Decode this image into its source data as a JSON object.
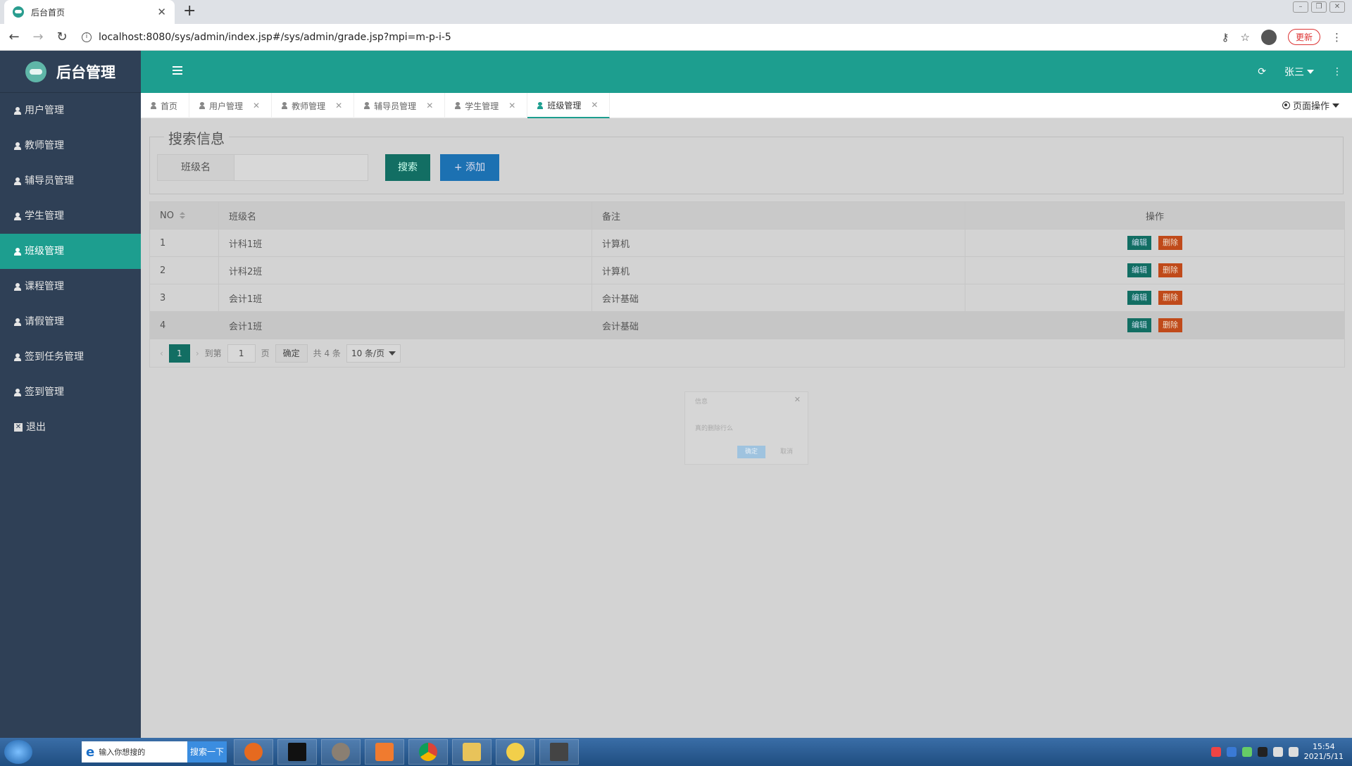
{
  "browser": {
    "tab_title": "后台首页",
    "url": "localhost:8080/sys/admin/index.jsp#/sys/admin/grade.jsp?mpi=m-p-i-5",
    "update_label": "更新"
  },
  "app": {
    "logo_text": "后台管理",
    "user_name": "张三",
    "page_ops_label": "页面操作"
  },
  "sidebar": {
    "items": [
      {
        "label": "用户管理"
      },
      {
        "label": "教师管理"
      },
      {
        "label": "辅导员管理"
      },
      {
        "label": "学生管理"
      },
      {
        "label": "班级管理"
      },
      {
        "label": "课程管理"
      },
      {
        "label": "请假管理"
      },
      {
        "label": "签到任务管理"
      },
      {
        "label": "签到管理"
      },
      {
        "label": "退出"
      }
    ],
    "active_index": 4
  },
  "tabs": [
    {
      "label": "首页"
    },
    {
      "label": "用户管理"
    },
    {
      "label": "教师管理"
    },
    {
      "label": "辅导员管理"
    },
    {
      "label": "学生管理"
    },
    {
      "label": "班级管理"
    }
  ],
  "search": {
    "legend": "搜索信息",
    "field_label": "班级名",
    "search_button": "搜索",
    "add_button": "添加"
  },
  "table": {
    "headers": [
      "NO",
      "班级名",
      "备注",
      "操作"
    ],
    "rows": [
      {
        "no": "1",
        "name": "计科1班",
        "remark": "计算机"
      },
      {
        "no": "2",
        "name": "计科2班",
        "remark": "计算机"
      },
      {
        "no": "3",
        "name": "会计1班",
        "remark": "会计基础"
      },
      {
        "no": "4",
        "name": "会计1班",
        "remark": "会计基础"
      }
    ],
    "edit_label": "编辑",
    "delete_label": "删除"
  },
  "pager": {
    "current_page": "1",
    "goto_label": "到第",
    "goto_value": "1",
    "page_suffix": "页",
    "confirm_label": "确定",
    "total_label": "共 4 条",
    "page_size": "10 条/页"
  },
  "dialog": {
    "title": "信息",
    "message": "真的删除行么",
    "ok_label": "确定",
    "cancel_label": "取消"
  },
  "taskbar": {
    "search_placeholder": "输入你想搜的",
    "search_button": "搜索一下",
    "time": "15:54",
    "date": "2021/5/11"
  }
}
